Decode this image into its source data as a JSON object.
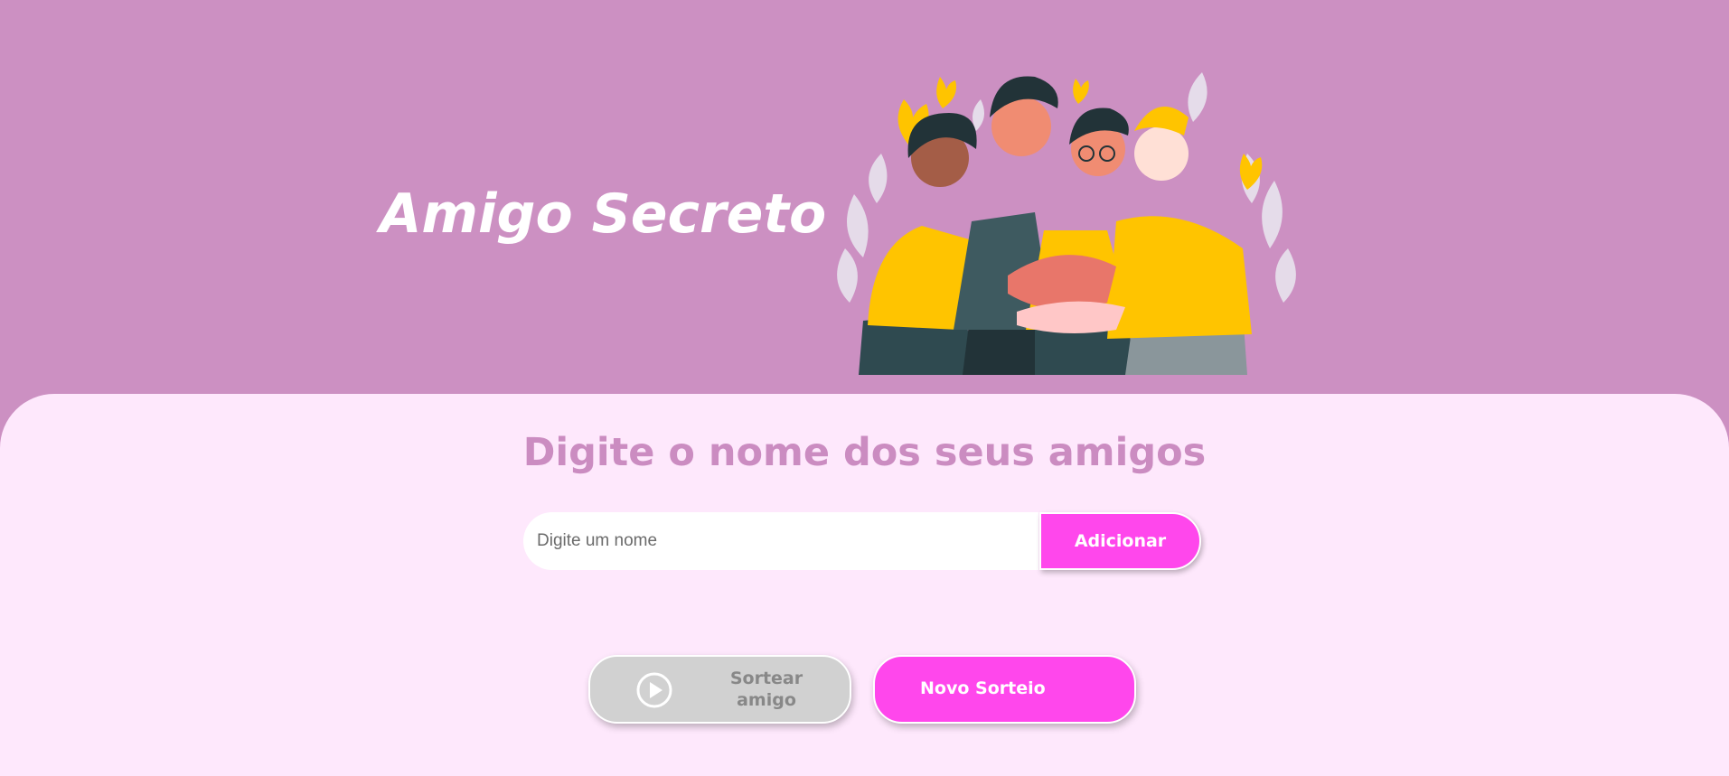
{
  "header": {
    "title": "Amigo Secreto",
    "illustration": "friends-group-hug-illustration"
  },
  "main": {
    "subtitle": "Digite o nome dos seus amigos",
    "name_input": {
      "value": "",
      "placeholder": "Digite um nome"
    },
    "add_button_label": "Adicionar",
    "draw_button": {
      "label": "Sortear amigo",
      "icon": "play-circle-icon",
      "disabled": true
    },
    "new_draw_button_label": "Novo Sorteio"
  },
  "colors": {
    "header_bg": "#cc90c2",
    "main_bg": "#fee8fc",
    "accent": "#ff47ec",
    "subtitle": "#cb8cc1",
    "disabled_bg": "#d1d1d1",
    "disabled_text": "#888888"
  }
}
